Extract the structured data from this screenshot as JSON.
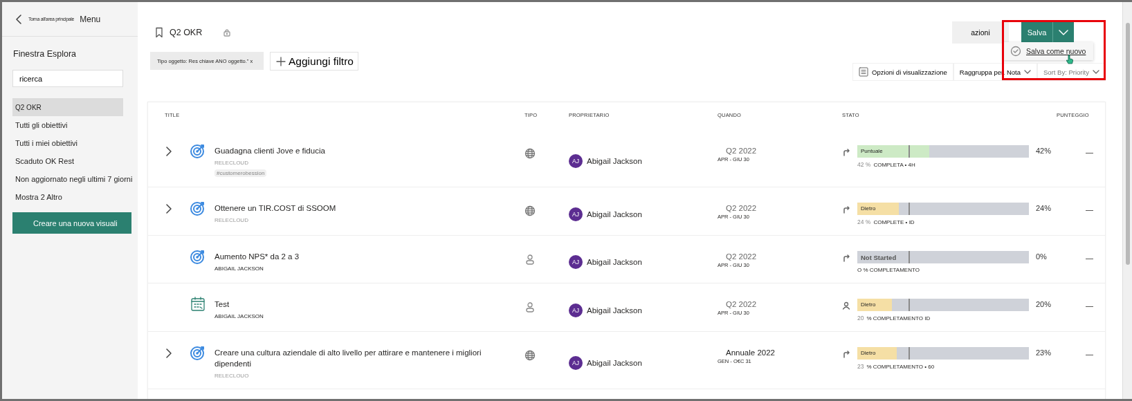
{
  "sidebar": {
    "back_label": "Torna all'area principale",
    "menu_label": "Menu",
    "title": "Finestra Esplora",
    "search": {
      "value": "ricerca"
    },
    "items": [
      {
        "label": "Q2 OKR",
        "selected": true
      },
      {
        "label": "Tutti gli obiettivi",
        "selected": false
      },
      {
        "label": "Tutti i miei obiettivi",
        "selected": false
      },
      {
        "label": "Scaduto OK Rest",
        "selected": false
      },
      {
        "label": "Non aggiornato negli ultimi 7 giorni",
        "selected": false
      },
      {
        "label": "Mostra 2 Altro",
        "selected": false
      }
    ],
    "create_button": "Creare una nuova visuali"
  },
  "header": {
    "title": "Q2 OKR",
    "actions_button": "azioni",
    "save_button": "Salva",
    "save_menu": {
      "item": "Salva come nuovo"
    }
  },
  "filters": {
    "chip": "Tipo oggetto: Res chiave ANO oggetto.\" x",
    "add_button": "Aggiungi filtro",
    "view_options": "Opzioni di visualizzazione",
    "group_by": "Raggruppa per. Nota",
    "sort_by": "Sort By: Priority"
  },
  "table": {
    "columns": [
      "TITLE",
      "TIPO",
      "PROPRIETARIO",
      "QUANDO",
      "STATO",
      "PUNTEGGIO"
    ],
    "rows": [
      {
        "expandable": true,
        "icon": {
          "kind": "target"
        },
        "title": "Guadagna clienti Jove e fiducia",
        "subtitle": "RELECLOUD",
        "tag": "#customerobession",
        "type": {
          "kind": "globe"
        },
        "owner_initials": "AJ",
        "owner": "Abigail Jackson",
        "period": "Q2 2022",
        "range": "APR - GIU 30",
        "trend": {
          "kind": "arrow"
        },
        "status": {
          "kind": "ontrack",
          "label": "Puntuale",
          "level": 0.42
        },
        "percent": "42%",
        "completion_pct": "42 %",
        "completion": "COMPLETA • 4H",
        "score": "—"
      },
      {
        "expandable": true,
        "icon": {
          "kind": "target"
        },
        "title": "Ottenere un TIR.COST di SSOOM",
        "subtitle": "RELECLOUD",
        "type": {
          "kind": "globe"
        },
        "owner_initials": "AJ",
        "owner": "Abigail Jackson",
        "period": "Q2 2022",
        "range": "APR - GIU 30",
        "trend": {
          "kind": "arrow"
        },
        "status": {
          "kind": "behind",
          "label": "Dietro",
          "level": 0.24
        },
        "percent": "24%",
        "completion_pct": "24 %",
        "completion": "COMPLETE • ID",
        "score": "—"
      },
      {
        "expandable": false,
        "icon": {
          "kind": "target"
        },
        "title": "Aumento NPS* da 2 a 3",
        "subtitle": "ABIGAIL JACKSON",
        "type": {
          "kind": "person"
        },
        "owner_initials": "AJ",
        "owner": "Abigail Jackson",
        "period": "Q2 2022",
        "range": "APR - GIU 30",
        "trend": {
          "kind": "arrow"
        },
        "status": {
          "kind": "notstarted",
          "label": "Not Started",
          "level": 0
        },
        "percent": "0%",
        "completion": "O % COMPLETAMENTO",
        "score": "—"
      },
      {
        "expandable": false,
        "icon": {
          "kind": "calendar"
        },
        "title": "Test",
        "subtitle": "ABIGAIL JACKSON",
        "type": {
          "kind": "person"
        },
        "owner_initials": "AJ",
        "owner": "Abigail Jackson",
        "period": "Q2 2022",
        "range": "APR - GIU 30",
        "trend": {
          "kind": "person"
        },
        "status": {
          "kind": "behind",
          "label": "Dietro",
          "level": 0.2
        },
        "percent": "20%",
        "completion_pct": "20",
        "completion": "% COMPLETAMENTO ID",
        "score": "—"
      },
      {
        "expandable": true,
        "icon": {
          "kind": "target"
        },
        "title": "Creare una cultura aziendale di alto livello per attirare e mantenere i migliori dipendenti",
        "subtitle": "RELECLOUO",
        "type": {
          "kind": "globe"
        },
        "owner_initials": "AJ",
        "owner": "Abigail Jackson",
        "period": "Annuale 2022",
        "range": "GEN - O€C 31",
        "trend": {
          "kind": "arrow"
        },
        "status": {
          "kind": "behind",
          "label": "Dietro",
          "level": 0.23
        },
        "percent": "23%",
        "completion_pct": "23",
        "completion": "% COMPLETAMENTO • 60",
        "score": "—"
      }
    ]
  }
}
